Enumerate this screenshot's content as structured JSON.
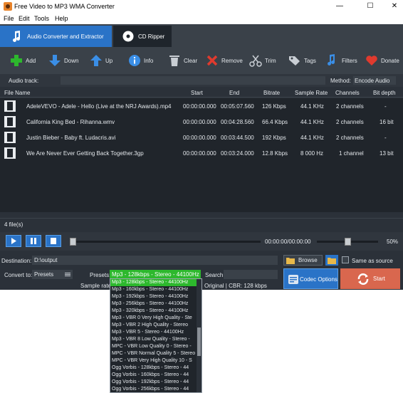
{
  "window": {
    "title": "Free Video to MP3 WMA Converter",
    "minimize": "—",
    "maximize": "☐",
    "close": "✕"
  },
  "menu": [
    "File",
    "Edit",
    "Tools",
    "Help"
  ],
  "tabs": [
    {
      "label": "Audio Converter and Extractor",
      "active": true,
      "icon": "music-note-icon"
    },
    {
      "label": "CD Ripper",
      "active": false,
      "icon": "cd-icon"
    }
  ],
  "toolbar": [
    {
      "label": "Add",
      "icon": "add-icon"
    },
    {
      "label": "Down",
      "icon": "arrow-down-icon"
    },
    {
      "label": "Up",
      "icon": "arrow-up-icon"
    },
    {
      "label": "Info",
      "icon": "info-icon"
    },
    {
      "label": "Clear",
      "icon": "trash-icon"
    },
    {
      "label": "Remove",
      "icon": "remove-icon"
    },
    {
      "label": "Trim",
      "icon": "scissors-icon"
    },
    {
      "label": "Tags",
      "icon": "tags-icon"
    },
    {
      "label": "Filters",
      "icon": "filters-icon"
    },
    {
      "label": "Donate",
      "icon": "heart-icon"
    }
  ],
  "audio_track": {
    "label": "Audio track:",
    "value": ""
  },
  "method": {
    "label": "Method:",
    "value": "Encode Audio"
  },
  "columns": [
    "File Name",
    "Start",
    "End",
    "Bitrate",
    "Sample Rate",
    "Channels",
    "Bit depth"
  ],
  "files": [
    {
      "name": "AdeleVEVO - Adele - Hello (Live at the NRJ Awards).mp4",
      "start": "00:00:00.000",
      "end": "00:05:07.560",
      "bitrate": "126 Kbps",
      "sample_rate": "44.1 KHz",
      "channels": "2 channels",
      "bit_depth": "-"
    },
    {
      "name": "California King Bed - Rihanna.wmv",
      "start": "00:00:00.000",
      "end": "00:04:28.560",
      "bitrate": "66.4 Kbps",
      "sample_rate": "44.1 KHz",
      "channels": "2 channels",
      "bit_depth": "16 bit"
    },
    {
      "name": "Justin Bieber - Baby ft. Ludacris.avi",
      "start": "00:00:00.000",
      "end": "00:03:44.500",
      "bitrate": "192 Kbps",
      "sample_rate": "44.1 KHz",
      "channels": "2 channels",
      "bit_depth": "-"
    },
    {
      "name": "We Are Never Ever Getting Back Together.3gp",
      "start": "00:00:00.000",
      "end": "00:03:24.000",
      "bitrate": "12.8 Kbps",
      "sample_rate": "8 000 Hz",
      "channels": "1 channel",
      "bit_depth": "13 bit"
    }
  ],
  "file_count": "4 file(s)",
  "player": {
    "timecode": "00:00:00/00:00:00",
    "volume": "50%",
    "volume_level": 0.5,
    "position": 0
  },
  "destination": {
    "label": "Destination:",
    "value": "D:\\output",
    "browse": "Browse",
    "same_as_source": "Same as source"
  },
  "convert_to": {
    "label": "Convert to:",
    "value": "Presets"
  },
  "presets": {
    "label": "Presets:",
    "value": "Mp3 - 128kbps - Stereo - 44100Hz"
  },
  "search": {
    "label": "Search:",
    "value": ""
  },
  "sample_rate": {
    "label": "Sample rate:"
  },
  "info_text": "Original | CBR: 128 kbps",
  "codec_options": "Codec Options",
  "start": "Start",
  "preset_options": [
    "Mp3 - 128kbps - Stereo - 44100Hz",
    "Mp3 - 160kbps - Stereo - 44100Hz",
    "Mp3 - 192kbps - Stereo - 44100Hz",
    "Mp3 - 256kbps - Stereo - 44100Hz",
    "Mp3 - 320kbps - Stereo - 44100Hz",
    "Mp3 - VBR 0 Very High Quality - Ste",
    "Mp3 - VBR 2 High Quality - Stereo",
    "Mp3 - VBR 5 - Stereo - 44100Hz",
    "Mp3 - VBR 8 Low Quality - Stereo -",
    "MPC - VBR Low Quality 0 - Stereo -",
    "MPC - VBR Normal Quality 5 - Stereo",
    "MPC - VBR Very High Quality 10 - S",
    "Ogg Vorbis - 128kbps - Stereo - 44",
    "Ogg Vorbis - 160kbps - Stereo - 44",
    "Ogg Vorbis - 192kbps - Stereo - 44",
    "Ogg Vorbis - 256kbps - Stereo - 44"
  ],
  "colors": {
    "accent": "#2a73c7",
    "selected": "#2db82d",
    "start_button": "#d9674e",
    "bg": "#2b3139"
  }
}
